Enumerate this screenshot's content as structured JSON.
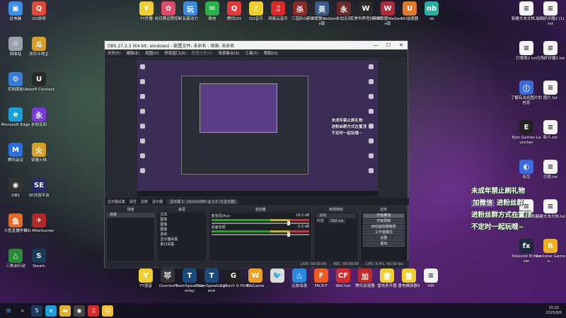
{
  "desktop": {
    "left_icons": [
      {
        "label": "此电脑",
        "color": "#3a8ee6",
        "glyph": "▣"
      },
      {
        "label": "QQ游戏",
        "color": "#e04a3a",
        "glyph": "Q"
      },
      {
        "label": "回收站",
        "color": "#9aa3ad",
        "glyph": "♲"
      },
      {
        "label": "双乐斗地主",
        "color": "#d8a02a",
        "glyph": "斗"
      },
      {
        "label": "控制面板",
        "color": "#3b7bd8",
        "glyph": "⚙"
      },
      {
        "label": "Ubisoft Connect",
        "color": "#2a2a2a",
        "glyph": "U"
      },
      {
        "label": "Microsoft Edge",
        "color": "#1a9fd8",
        "glyph": "e"
      },
      {
        "label": "永劫无间",
        "color": "#7a3ad8",
        "glyph": "永"
      },
      {
        "label": "腾讯会议",
        "color": "#2a6fe0",
        "glyph": "M"
      },
      {
        "label": "穿越火线",
        "color": "#d8a02a",
        "glyph": "火"
      },
      {
        "label": "OBS",
        "color": "#333",
        "glyph": "◉"
      },
      {
        "label": "SE对战平台",
        "color": "#2a2a6a",
        "glyph": "SE"
      },
      {
        "label": "斗鱼直播伴侣",
        "color": "#e06a2a",
        "glyph": "鱼"
      },
      {
        "label": "MSI Afterburner",
        "color": "#b02a2a",
        "glyph": "✈"
      },
      {
        "label": "三角洲行动",
        "color": "#2a8a3a",
        "glyph": "△"
      },
      {
        "label": "Steam",
        "color": "#1a3a5a",
        "glyph": "S"
      }
    ],
    "top_icons": [
      {
        "label": "YY开播",
        "color": "#f0d030",
        "glyph": "Y"
      },
      {
        "label": "向日葵远程控制",
        "color": "#e04a6a",
        "glyph": "✿"
      },
      {
        "label": "玩家动力",
        "color": "#3a8ae0",
        "glyph": "玩"
      },
      {
        "label": "微信",
        "color": "#2ab04a",
        "glyph": "✉"
      },
      {
        "label": "腾讯QQ",
        "color": "#e03a3a",
        "glyph": "Q"
      },
      {
        "label": "QQ音乐",
        "color": "#f0d030",
        "glyph": "♪"
      },
      {
        "label": "网易云音乐",
        "color": "#d82a2a",
        "glyph": "♫"
      },
      {
        "label": "三国杀OL",
        "color": "#8a2a2a",
        "glyph": "杀"
      },
      {
        "label": "英雄联盟WeGame版",
        "color": "#3a5a8a",
        "glyph": "英"
      },
      {
        "label": "永劫无间",
        "color": "#6a2a2a",
        "glyph": "永"
      },
      {
        "label": "完美世界竞技平台",
        "color": "#2a2a2a",
        "glyph": "W"
      },
      {
        "label": "英雄联盟WeGame版",
        "color": "#b02a3a",
        "glyph": "W"
      },
      {
        "label": "UU加速器",
        "color": "#e07a2a",
        "glyph": "U"
      },
      {
        "label": "nb",
        "color": "#2ab0a0",
        "glyph": "nb"
      }
    ],
    "right_icons": [
      {
        "label": "新建文本文档.txt",
        "color": "#f4f4f4",
        "glyph": "≡"
      },
      {
        "label": "马场好评器2 (1).txt",
        "color": "#f4f4f4",
        "glyph": "≡"
      },
      {
        "label": "打榜表2.txt",
        "color": "#f4f4f4",
        "glyph": "≡"
      },
      {
        "label": "马场好评器2.txt",
        "color": "#f4f4f4",
        "glyph": "≡"
      },
      {
        "label": "了解有关此图片的信息",
        "color": "#3a6ad8",
        "glyph": "ⓘ"
      },
      {
        "label": "图片.txt",
        "color": "#f4f4f4",
        "glyph": "≡"
      },
      {
        "label": "Epic Games Launcher",
        "color": "#222",
        "glyph": "E"
      },
      {
        "label": "新人.txt",
        "color": "#f4f4f4",
        "glyph": "≡"
      },
      {
        "label": "夸克",
        "color": "#3a6ae0",
        "glyph": "◐"
      },
      {
        "label": "打榜.txt",
        "color": "#f4f4f4",
        "glyph": "≡"
      },
      {
        "label": "新建文本文档(2)",
        "color": "#f4f4f4",
        "glyph": "≡"
      },
      {
        "label": "新建文本文档.txt",
        "color": "#f4f4f4",
        "glyph": "≡"
      },
      {
        "label": "fxSound Enhancer",
        "color": "#1a2a3a",
        "glyph": "fx"
      },
      {
        "label": "Rockstar Games...",
        "color": "#f0b020",
        "glyph": "R"
      }
    ],
    "bottom_icons": [
      {
        "label": "YY语音",
        "color": "#f0d030",
        "glyph": "Y"
      },
      {
        "label": "Overwolf",
        "color": "#333",
        "glyph": "🐺"
      },
      {
        "label": "TeamSpeak Overlay",
        "color": "#1a4a7a",
        "glyph": "T"
      },
      {
        "label": "TeamSpeak 3 Client",
        "color": "#1a4a7a",
        "glyph": "T"
      },
      {
        "label": "Logitech G HUB",
        "color": "#222",
        "glyph": "G"
      },
      {
        "label": "WeGame",
        "color": "#f0a020",
        "glyph": "W"
      },
      {
        "label": "",
        "color": "#ddd",
        "glyph": "🐦"
      },
      {
        "label": "迅游加速",
        "color": "#2a8ae0",
        "glyph": "△"
      },
      {
        "label": "FACEIT",
        "color": "#f05a20",
        "glyph": "F"
      },
      {
        "label": "WeChat",
        "color": "#d82a2a",
        "glyph": "CF"
      },
      {
        "label": "腾讯加速器",
        "color": "#c02a2a",
        "glyph": "加"
      },
      {
        "label": "雷电多开器",
        "color": "#f0d030",
        "glyph": "雷"
      },
      {
        "label": "雷电模拟器9",
        "color": "#f0d030",
        "glyph": "雷"
      },
      {
        "label": "HIR",
        "color": "#f4f4f4",
        "glyph": "≡"
      }
    ]
  },
  "obs": {
    "title": "OBS 27.2.3 (64-bit, windows) - 配置文件: 未命名 - 场景: 未命名",
    "menu": [
      "文件(F)",
      "编辑(E)",
      "视图(V)",
      "停靠窗口(D)",
      "配置文件(P)",
      "场景集合(S)",
      "工具(T)",
      "帮助(H)"
    ],
    "source_toolbar": [
      "显示器采集",
      "属性",
      "滤镜",
      "显示器",
      "显示器 1: 1920x1080 @ 0,0 (主显示器)"
    ],
    "docks": {
      "scenes_title": "场景",
      "scenes": [
        "场景"
      ],
      "sources_title": "来源",
      "sources": [
        "文本",
        "图像",
        "图像",
        "图像",
        "游戏",
        "显示器采集",
        "窗口采集"
      ],
      "mixer_title": "混音器",
      "mixer": [
        {
          "name": "麦克风/Aux",
          "db": "18.0 dB"
        },
        {
          "name": "桌面音频",
          "db": "0.0 dB"
        }
      ],
      "transition_title": "转场特效",
      "transition_type": "淡出",
      "duration_label": "时长",
      "duration_value": "300 ms",
      "controls_title": "控件",
      "controls": [
        "开始推流",
        "开始录制",
        "启动虚拟摄像机",
        "工作室模式",
        "设置",
        "退出"
      ]
    },
    "status": {
      "live": "LIVE: 00:00:00",
      "rec": "REC: 00:00:00",
      "cpu": "CPU: 0.4%, 60.00 fps"
    }
  },
  "overlay_text": {
    "line1": "未成年禁止刷礼物",
    "highlight": "加微信",
    "line2_rest": "进粉丝群",
    "line3": "进粉丝群方式在置顶",
    "line4": "不定时一起玩哦~"
  },
  "taskbar": {
    "clock_time": "15:02",
    "clock_date": "2025/8/6"
  }
}
